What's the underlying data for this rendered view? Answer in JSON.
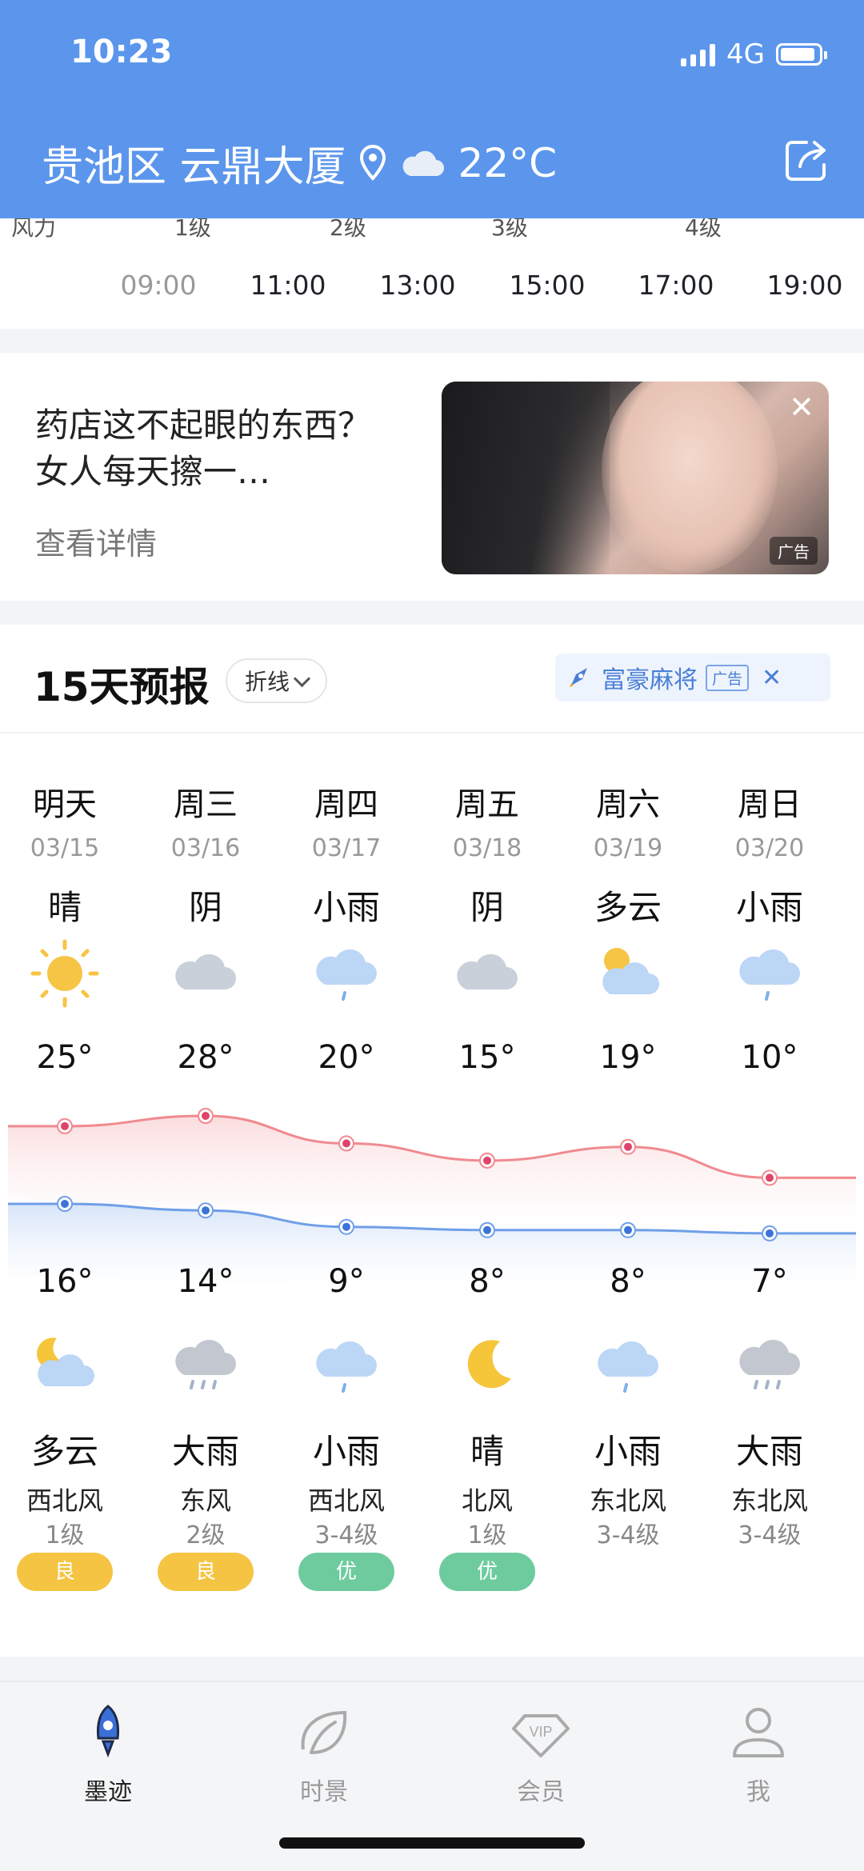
{
  "status_bar": {
    "time": "10:23",
    "network": "4G"
  },
  "header": {
    "location": "贵池区 云鼎大厦",
    "temperature": "22°C",
    "weather_icon": "cloud-icon"
  },
  "hourly": {
    "wind_label": "风力",
    "wind_levels": [
      "1级",
      "2级",
      "3级",
      "4级"
    ],
    "hours": [
      "09:00",
      "11:00",
      "13:00",
      "15:00",
      "17:00",
      "19:00"
    ]
  },
  "ad_card": {
    "title": "药店这不起眼的东西？女人每天擦一…",
    "detail": "查看详情",
    "tag": "广告"
  },
  "forecast": {
    "title": "15天预报",
    "mode": "折线",
    "ad_banner": {
      "text": "富豪麻将",
      "tag": "广告"
    },
    "days": [
      {
        "name": "明天",
        "date": "03/15",
        "day_cond": "晴",
        "day_icon": "sun-icon",
        "high": "25°",
        "low": "16°",
        "night_icon": "moon-cloud-icon",
        "night_cond": "多云",
        "wind_dir": "西北风",
        "wind_lvl": "1级",
        "aqi": "良",
        "aqi_color": "#f5c443"
      },
      {
        "name": "周三",
        "date": "03/16",
        "day_cond": "阴",
        "day_icon": "cloud-icon",
        "high": "28°",
        "low": "14°",
        "night_icon": "heavy-rain-icon",
        "night_cond": "大雨",
        "wind_dir": "东风",
        "wind_lvl": "2级",
        "aqi": "良",
        "aqi_color": "#f5c443"
      },
      {
        "name": "周四",
        "date": "03/17",
        "day_cond": "小雨",
        "day_icon": "light-rain-icon",
        "high": "20°",
        "low": "9°",
        "night_icon": "light-rain-icon",
        "night_cond": "小雨",
        "wind_dir": "西北风",
        "wind_lvl": "3-4级",
        "aqi": "优",
        "aqi_color": "#6ecb9e"
      },
      {
        "name": "周五",
        "date": "03/18",
        "day_cond": "阴",
        "day_icon": "cloud-icon",
        "high": "15°",
        "low": "8°",
        "night_icon": "moon-icon",
        "night_cond": "晴",
        "wind_dir": "北风",
        "wind_lvl": "1级",
        "aqi": "优",
        "aqi_color": "#6ecb9e"
      },
      {
        "name": "周六",
        "date": "03/19",
        "day_cond": "多云",
        "day_icon": "sun-cloud-icon",
        "high": "19°",
        "low": "8°",
        "night_icon": "light-rain-icon",
        "night_cond": "小雨",
        "wind_dir": "东北风",
        "wind_lvl": "3-4级",
        "aqi": "",
        "aqi_color": ""
      },
      {
        "name": "周日",
        "date": "03/20",
        "day_cond": "小雨",
        "day_icon": "light-rain-icon",
        "high": "10°",
        "low": "7°",
        "night_icon": "heavy-rain-icon",
        "night_cond": "大雨",
        "wind_dir": "东北风",
        "wind_lvl": "3-4级",
        "aqi": "",
        "aqi_color": ""
      }
    ]
  },
  "tabbar": {
    "items": [
      {
        "label": "墨迹",
        "icon": "rocket-icon",
        "active": true
      },
      {
        "label": "时景",
        "icon": "leaf-icon",
        "active": false
      },
      {
        "label": "会员",
        "icon": "vip-diamond-icon",
        "active": false
      },
      {
        "label": "我",
        "icon": "person-icon",
        "active": false
      }
    ]
  },
  "colors": {
    "header_bg": "#5b96ec",
    "high_line": "#f08a8f",
    "low_line": "#6f9fe8",
    "accent": "#4a7fd6"
  }
}
